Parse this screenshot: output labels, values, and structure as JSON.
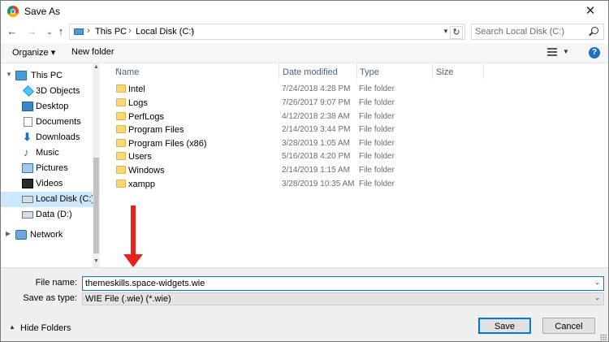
{
  "window": {
    "title": "Save As",
    "close_glyph": "✕"
  },
  "nav_buttons": {
    "back": "←",
    "forward": "→",
    "dropdown": "⌄",
    "up": "↑"
  },
  "address": {
    "crumbs": [
      "This PC",
      "Local Disk (C:)"
    ],
    "separator": "›",
    "refresh": "↻"
  },
  "search": {
    "placeholder": "Search Local Disk (C:)"
  },
  "toolbar": {
    "organize": "Organize ▾",
    "new_folder": "New folder",
    "help": "?"
  },
  "sidebar": {
    "items": [
      {
        "label": "This PC",
        "icon": "pc-icon",
        "level": 0,
        "selected": false
      },
      {
        "label": "3D Objects",
        "icon": "3d-objects-icon",
        "level": 1,
        "selected": false
      },
      {
        "label": "Desktop",
        "icon": "desktop-icon",
        "level": 1,
        "selected": false
      },
      {
        "label": "Documents",
        "icon": "documents-icon",
        "level": 1,
        "selected": false
      },
      {
        "label": "Downloads",
        "icon": "downloads-icon",
        "level": 1,
        "selected": false
      },
      {
        "label": "Music",
        "icon": "music-icon",
        "level": 1,
        "selected": false
      },
      {
        "label": "Pictures",
        "icon": "pictures-icon",
        "level": 1,
        "selected": false
      },
      {
        "label": "Videos",
        "icon": "videos-icon",
        "level": 1,
        "selected": false
      },
      {
        "label": "Local Disk (C:)",
        "icon": "local-disk-icon",
        "level": 1,
        "selected": true
      },
      {
        "label": "Data (D:)",
        "icon": "data-disk-icon",
        "level": 1,
        "selected": false
      },
      {
        "label": "Network",
        "icon": "network-icon",
        "level": 0,
        "selected": false
      }
    ]
  },
  "columns": [
    "Name",
    "Date modified",
    "Type",
    "Size"
  ],
  "files": [
    {
      "name": "Intel",
      "date": "7/24/2018 4:28 PM",
      "type": "File folder"
    },
    {
      "name": "Logs",
      "date": "7/26/2017 9:07 PM",
      "type": "File folder"
    },
    {
      "name": "PerfLogs",
      "date": "4/12/2018 2:38 AM",
      "type": "File folder"
    },
    {
      "name": "Program Files",
      "date": "2/14/2019 3:44 PM",
      "type": "File folder"
    },
    {
      "name": "Program Files (x86)",
      "date": "3/28/2019 1:05 AM",
      "type": "File folder"
    },
    {
      "name": "Users",
      "date": "5/16/2018 4:20 PM",
      "type": "File folder"
    },
    {
      "name": "Windows",
      "date": "2/14/2019 1:15 AM",
      "type": "File folder"
    },
    {
      "name": "xampp",
      "date": "3/28/2019 10:35 AM",
      "type": "File folder"
    }
  ],
  "form": {
    "file_name_label": "File name:",
    "file_name_value": "themeskills.space-widgets.wie",
    "save_as_type_label": "Save as type:",
    "save_as_type_value": "WIE File (.wie) (*.wie)"
  },
  "footer": {
    "hide_folders": "Hide Folders",
    "save": "Save",
    "cancel": "Cancel"
  },
  "colors": {
    "selection": "#cce8ff",
    "annotation_arrow": "#e8231d",
    "focus_border": "#0078d7"
  }
}
